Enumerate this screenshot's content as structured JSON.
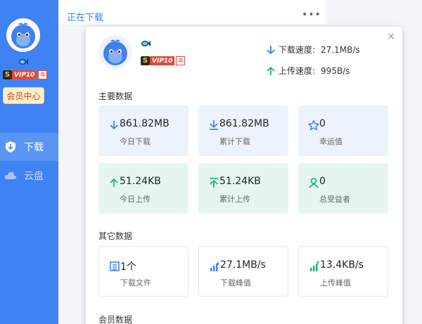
{
  "sidebar": {
    "vip_label": "VIP10",
    "vip_year": "年",
    "member_center": "会员中心",
    "nav": [
      {
        "label": "下载",
        "icon": "download-shield-icon",
        "active": true
      },
      {
        "label": "云盘",
        "icon": "cloud-icon",
        "active": false
      }
    ]
  },
  "tabbar": {
    "title": "正在下载",
    "more": "•••"
  },
  "panel": {
    "close": "×",
    "vip_label": "VIP10",
    "vip_year": "年",
    "download_speed_label": "下载速度:",
    "download_speed_value": "27.1MB/s",
    "upload_speed_label": "上传速度:",
    "upload_speed_value": "995B/s",
    "main_section": "主要数据",
    "other_section": "其它数据",
    "member_section": "会员数据",
    "main_cards": [
      {
        "value": "861.82MB",
        "label": "今日下载",
        "icon": "download-arrow-icon",
        "style": "blue"
      },
      {
        "value": "861.82MB",
        "label": "累计下载",
        "icon": "download-to-bar-icon",
        "style": "blue"
      },
      {
        "value": "0",
        "label": "幸运值",
        "icon": "star-icon",
        "style": "blue"
      },
      {
        "value": "51.24KB",
        "label": "今日上传",
        "icon": "upload-arrow-icon",
        "style": "green"
      },
      {
        "value": "51.24KB",
        "label": "累计上传",
        "icon": "upload-from-bar-icon",
        "style": "green"
      },
      {
        "value": "0",
        "label": "总受益者",
        "icon": "user-icon",
        "style": "green"
      }
    ],
    "other_cards": [
      {
        "value": "1个",
        "label": "下载文件",
        "icon": "file-list-icon"
      },
      {
        "value": "27.1MB/s",
        "label": "下载峰值",
        "icon": "download-peak-icon"
      },
      {
        "value": "13.4KB/s",
        "label": "上传峰值",
        "icon": "upload-peak-icon"
      }
    ]
  },
  "colors": {
    "brand_blue": "#3f82f3",
    "upload_green": "#1fb57a",
    "card_blue_bg": "#edf3fd",
    "card_green_bg": "#e6f6ef"
  }
}
